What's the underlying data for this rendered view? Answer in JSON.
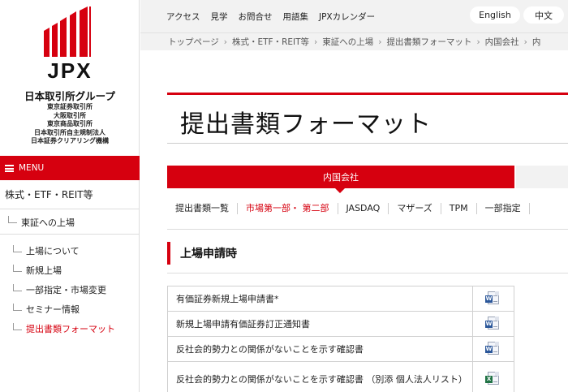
{
  "brand": {
    "logo_text": "JPX",
    "group_name": "日本取引所グループ",
    "subsidiaries": [
      "東京証券取引所",
      "大阪取引所",
      "東京商品取引所",
      "日本取引所自主規制法人",
      "日本証券クリアリング機構"
    ],
    "logo_color": "#d6000f"
  },
  "sidebar": {
    "menu_label": "MENU",
    "level1": "株式・ETF・REIT等",
    "level2": "東証への上場",
    "items": [
      {
        "label": "上場について",
        "active": false
      },
      {
        "label": "新規上場",
        "active": false
      },
      {
        "label": "一部指定・市場変更",
        "active": false
      },
      {
        "label": "セミナー情報",
        "active": false
      },
      {
        "label": "提出書類フォーマット",
        "active": true
      }
    ]
  },
  "topbar": {
    "nav": [
      "アクセス",
      "見学",
      "お問合せ",
      "用語集",
      "JPXカレンダー"
    ],
    "lang_english": "English",
    "lang_chinese": "中文"
  },
  "breadcrumb": [
    "トップページ",
    "株式・ETF・REIT等",
    "東証への上場",
    "提出書類フォーマット",
    "内国会社",
    "内"
  ],
  "main": {
    "title": "提出書類フォーマット",
    "active_tab": "内国会社",
    "subnav": [
      {
        "label": "提出書類一覧",
        "active": false
      },
      {
        "label": "市場第一部・ 第二部",
        "active": true
      },
      {
        "label": "JASDAQ",
        "active": false
      },
      {
        "label": "マザーズ",
        "active": false
      },
      {
        "label": "TPM",
        "active": false
      },
      {
        "label": "一部指定",
        "active": false
      }
    ],
    "section_heading": "上場申請時",
    "documents": [
      {
        "name": "有価証券新規上場申請書*",
        "file_icon": "word-icon"
      },
      {
        "name": "新規上場申請有価証券訂正通知書",
        "file_icon": "word-icon"
      },
      {
        "name": "反社会的勢力との関係がないことを示す確認書",
        "file_icon": "word-icon"
      },
      {
        "name": "反社会的勢力との関係がないことを示す確認書 （別添 個人法人リスト）",
        "file_icon": "excel-icon"
      }
    ]
  },
  "colors": {
    "accent": "#d6000f",
    "topbar_bg": "#f2f2f2"
  }
}
